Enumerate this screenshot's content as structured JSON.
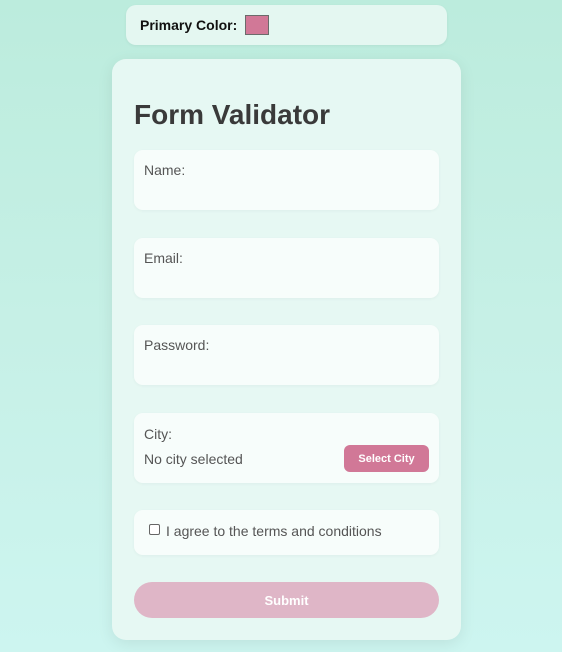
{
  "color_picker": {
    "label": "Primary Color:",
    "value": "#d17897"
  },
  "form": {
    "title": "Form Validator",
    "name_label": "Name:",
    "email_label": "Email:",
    "password_label": "Password:",
    "city_label": "City:",
    "city_value": "No city selected",
    "select_city_button": "Select City",
    "terms_label": "I agree to the terms and conditions",
    "terms_checked": false,
    "submit_label": "Submit"
  },
  "colors": {
    "accent": "#d17897",
    "submit_disabled": "#dfb6c7",
    "background_top": "#bcecdd",
    "background_bottom": "#cdf5f0"
  }
}
